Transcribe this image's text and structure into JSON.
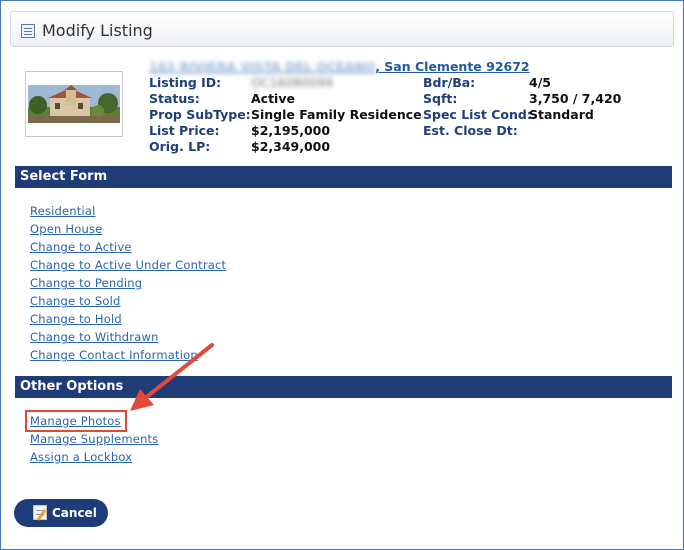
{
  "header": {
    "title": "Modify Listing"
  },
  "listing": {
    "address_redacted": "163 RIVIERA VISTA DEL OCEANO",
    "address_city": ", San Clemente 92672",
    "fields_left": [
      {
        "label": "Listing ID:",
        "value": "OC16080099",
        "redacted": true
      },
      {
        "label": "Status:",
        "value": "Active"
      },
      {
        "label": "Prop SubType:",
        "value": "Single Family Residence"
      },
      {
        "label": "List Price:",
        "value": "$2,195,000"
      },
      {
        "label": "Orig. LP:",
        "value": "$2,349,000"
      }
    ],
    "fields_right": [
      {
        "label": "Bdr/Ba:",
        "value": "4/5"
      },
      {
        "label": "Sqft:",
        "value": "3,750 / 7,420"
      },
      {
        "label": "Spec List Cond:",
        "value": "Standard"
      },
      {
        "label": "Est. Close Dt:",
        "value": ""
      }
    ]
  },
  "select_form": {
    "heading": "Select Form",
    "links": [
      "Residential",
      "Open House",
      "Change to Active",
      "Change to Active Under Contract",
      "Change to Pending",
      "Change to Sold",
      "Change to Hold",
      "Change to Withdrawn",
      "Change Contact Information"
    ]
  },
  "other_options": {
    "heading": "Other Options",
    "links": [
      "Manage Photos",
      "Manage Supplements",
      "Assign a Lockbox"
    ]
  },
  "actions": {
    "cancel_label": "Cancel"
  },
  "colors": {
    "section_bar": "#1f3c78",
    "link": "#2864b0",
    "highlight": "#e14a3a"
  }
}
